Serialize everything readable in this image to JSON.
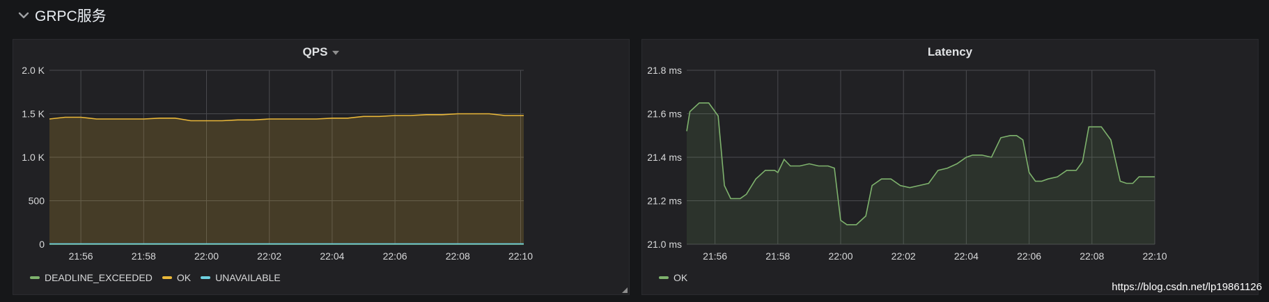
{
  "row": {
    "title": "GRPC服务",
    "chevron_icon": "chevron-down-icon"
  },
  "watermark": "https://blog.csdn.net/lp19861126",
  "colors": {
    "deadline": "#7eb26d",
    "ok": "#eab839",
    "unavailable": "#6ed0e0",
    "latency_ok": "#7eb26d"
  },
  "panels": {
    "qps": {
      "title": "QPS",
      "legend": [
        {
          "label": "DEADLINE_EXCEEDED",
          "color": "#7eb26d"
        },
        {
          "label": "OK",
          "color": "#eab839"
        },
        {
          "label": "UNAVAILABLE",
          "color": "#6ed0e0"
        }
      ]
    },
    "latency": {
      "title": "Latency",
      "legend": [
        {
          "label": "OK",
          "color": "#7eb26d"
        }
      ]
    }
  },
  "chart_data": [
    {
      "type": "area",
      "title": "QPS",
      "x_ticks": [
        "21:56",
        "21:58",
        "22:00",
        "22:02",
        "22:04",
        "22:06",
        "22:08",
        "22:10"
      ],
      "y_ticks": [
        "0",
        "500",
        "1.0 K",
        "1.5 K",
        "2.0 K"
      ],
      "ylim": [
        0,
        2000
      ],
      "xlim_minutes": [
        -1,
        14.1
      ],
      "grid": true,
      "legend_position": "bottom-left",
      "series": [
        {
          "name": "OK",
          "color": "#eab839",
          "minutes": [
            -1,
            -0.5,
            0,
            0.5,
            1,
            1.5,
            2,
            2.5,
            3,
            3.5,
            4,
            4.5,
            5,
            5.5,
            6,
            6.5,
            7,
            7.5,
            8,
            8.5,
            9,
            9.5,
            10,
            10.5,
            11,
            11.5,
            12,
            12.5,
            13,
            13.5,
            14,
            14.1
          ],
          "values": [
            1440,
            1460,
            1460,
            1440,
            1440,
            1440,
            1440,
            1450,
            1450,
            1420,
            1420,
            1420,
            1430,
            1430,
            1440,
            1440,
            1440,
            1440,
            1450,
            1450,
            1470,
            1470,
            1480,
            1480,
            1490,
            1490,
            1500,
            1500,
            1500,
            1480,
            1480,
            1480
          ]
        },
        {
          "name": "DEADLINE_EXCEEDED",
          "color": "#7eb26d",
          "minutes": [
            -1,
            14.1
          ],
          "values": [
            0,
            0
          ]
        },
        {
          "name": "UNAVAILABLE",
          "color": "#6ed0e0",
          "minutes": [
            -1,
            14.1
          ],
          "values": [
            5,
            5
          ]
        }
      ]
    },
    {
      "type": "area",
      "title": "Latency",
      "x_ticks": [
        "21:56",
        "21:58",
        "22:00",
        "22:02",
        "22:04",
        "22:06",
        "22:08",
        "22:10"
      ],
      "y_ticks": [
        "21.0 ms",
        "21.2 ms",
        "21.4 ms",
        "21.6 ms",
        "21.8 ms"
      ],
      "ylim": [
        21.0,
        21.8
      ],
      "xlim_minutes": [
        -0.9,
        14.0
      ],
      "grid": true,
      "legend_position": "bottom-left",
      "series": [
        {
          "name": "OK",
          "color": "#7eb26d",
          "minutes": [
            -0.9,
            -0.8,
            -0.5,
            -0.2,
            0.1,
            0.3,
            0.5,
            0.8,
            1.0,
            1.3,
            1.6,
            1.9,
            2.0,
            2.2,
            2.4,
            2.7,
            3.0,
            3.3,
            3.6,
            3.8,
            4.0,
            4.2,
            4.5,
            4.8,
            5.0,
            5.3,
            5.6,
            5.9,
            6.2,
            6.5,
            6.8,
            7.1,
            7.4,
            7.7,
            8.0,
            8.2,
            8.5,
            8.8,
            9.1,
            9.4,
            9.6,
            9.8,
            10.0,
            10.2,
            10.4,
            10.6,
            10.9,
            11.2,
            11.5,
            11.7,
            11.9,
            12.1,
            12.3,
            12.6,
            12.9,
            13.1,
            13.3,
            13.5,
            13.7,
            14.0
          ],
          "values": [
            21.52,
            21.61,
            21.65,
            21.65,
            21.59,
            21.27,
            21.21,
            21.21,
            21.23,
            21.3,
            21.34,
            21.34,
            21.33,
            21.39,
            21.36,
            21.36,
            21.37,
            21.36,
            21.36,
            21.35,
            21.11,
            21.09,
            21.09,
            21.13,
            21.27,
            21.3,
            21.3,
            21.27,
            21.26,
            21.27,
            21.28,
            21.34,
            21.35,
            21.37,
            21.4,
            21.41,
            21.41,
            21.4,
            21.49,
            21.5,
            21.5,
            21.48,
            21.33,
            21.29,
            21.29,
            21.3,
            21.31,
            21.34,
            21.34,
            21.38,
            21.54,
            21.54,
            21.54,
            21.48,
            21.29,
            21.28,
            21.28,
            21.31,
            21.31,
            21.31
          ]
        }
      ]
    }
  ]
}
